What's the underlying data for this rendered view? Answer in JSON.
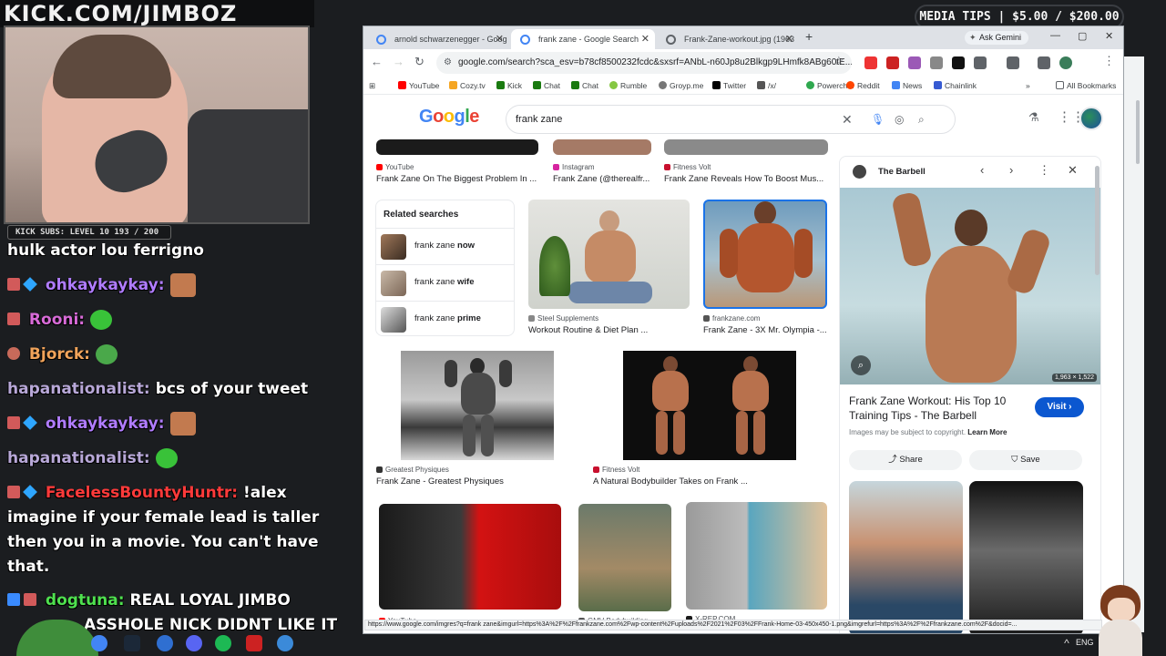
{
  "stream": {
    "channel": "KICK.COM/JIMBOZ",
    "media_tips": "MEDIA TIPS | $5.00 / $200.00",
    "subs_bar": "KICK SUBS: LEVEL 10 193 / 200",
    "chat": [
      {
        "user": "",
        "text": "hulk actor lou ferrigno",
        "user_color": "#ffffff"
      },
      {
        "user": "ohkaykaykay:",
        "text": "",
        "user_color": "#b07cff",
        "emote": "face"
      },
      {
        "user": "Rooni:",
        "text": "",
        "user_color": "#d86bd8",
        "emote": "green"
      },
      {
        "user": "Bjorck:",
        "text": "",
        "user_color": "#f0a35a",
        "emote": "green"
      },
      {
        "user": "hapanationalist:",
        "text": "bcs of your tweet",
        "user_color": "#b8a8d8"
      },
      {
        "user": "ohkaykaykay:",
        "text": "",
        "user_color": "#b07cff",
        "emote": "face"
      },
      {
        "user": "hapanationalist:",
        "text": "",
        "user_color": "#b8a8d8",
        "emote": "green"
      },
      {
        "user": "FacelessBountyHuntr:",
        "text": "!alex",
        "user_color": "#ff3a3a"
      },
      {
        "user": "",
        "text": "imagine if your female lead is taller",
        "user_color": "#ffffff"
      },
      {
        "user": "",
        "text": "then you in a movie. You can't have",
        "user_color": "#ffffff"
      },
      {
        "user": "",
        "text": "that.",
        "user_color": "#ffffff"
      },
      {
        "user": "dogtuna:",
        "text": "REAL LOYAL JIMBO",
        "user_color": "#4fe04f"
      },
      {
        "user": "",
        "text": "ASSHOLE NICK DIDNT LIKE IT",
        "user_color": "#ffffff"
      }
    ],
    "taskbar_lang": "ENG"
  },
  "browser": {
    "tabs": [
      {
        "label": "arnold schwarzenegger - Goog",
        "active": false
      },
      {
        "label": "frank zane - Google Search",
        "active": true
      },
      {
        "label": "Frank-Zane-workout.jpg (1963",
        "active": false
      }
    ],
    "ask_gemini": "Ask Gemini",
    "url": "google.com/search?sca_esv=b78cf8500232fcdc&sxsrf=ANbL-n60Jp8u2Blkgp9LHmfk8ABg60tE...",
    "bookmarks": [
      {
        "label": "YouTube",
        "color": "#ff0000"
      },
      {
        "label": "Cozy.tv",
        "color": "#f5a623"
      },
      {
        "label": "Kick",
        "color": "#53fc18"
      },
      {
        "label": "Chat",
        "color": "#53fc18"
      },
      {
        "label": "Chat",
        "color": "#53fc18"
      },
      {
        "label": "Rumble",
        "color": "#85c742"
      },
      {
        "label": "Groyp.me",
        "color": "#777777"
      },
      {
        "label": "Twitter",
        "color": "#000000"
      },
      {
        "label": "/x/",
        "color": "#555555"
      },
      {
        "label": "Powerchat",
        "color": "#2fa84f"
      },
      {
        "label": "Reddit",
        "color": "#ff4500"
      },
      {
        "label": "News",
        "color": "#4285f4"
      },
      {
        "label": "Chainlink",
        "color": "#375bd2"
      }
    ],
    "all_bookmarks": "All Bookmarks",
    "status_url": "https://www.google.com/imgres?q=frank zane&imgurl=https%3A%2F%2Ffrankzane.com%2Fwp-content%2Fuploads%2F2021%2F03%2FFrank-Home-03-450x450-1.png&imgrefurl=https%3A%2F%2Ffrankzane.com%2F&docid=..."
  },
  "google": {
    "logo": "Google",
    "query": "frank zane",
    "results": [
      {
        "source": "YouTube",
        "title": "Frank Zane On The Biggest Problem In ...",
        "src_color": "#ff0000"
      },
      {
        "source": "Instagram",
        "title": "Frank Zane (@therealfr...",
        "src_color": "#d6249f"
      },
      {
        "source": "Fitness Volt",
        "title": "Frank Zane Reveals How To Boost Mus...",
        "src_color": "#c8102e"
      },
      {
        "source": "Steel Supplements",
        "title": "Workout Routine & Diet Plan ...",
        "src_color": "#888888"
      },
      {
        "source": "frankzane.com",
        "title": "Frank Zane - 3X Mr. Olympia -...",
        "src_color": "#555555"
      },
      {
        "source": "Greatest Physiques",
        "title": "Frank Zane - Greatest Physiques",
        "src_color": "#333333"
      },
      {
        "source": "Fitness Volt",
        "title": "A Natural Bodybuilder Takes on Frank ...",
        "src_color": "#c8102e"
      }
    ],
    "related": {
      "heading": "Related searches",
      "items": [
        {
          "base": "frank zane",
          "bold": "now"
        },
        {
          "base": "frank zane",
          "bold": "wife"
        },
        {
          "base": "frank zane",
          "bold": "prime"
        }
      ]
    },
    "bottom_sources": [
      "YouTube",
      "GMV Bodybuilding",
      "X-REP.COM"
    ]
  },
  "panel": {
    "site": "The Barbell",
    "title": "Frank Zane Workout: His Top 10 Training Tips - The Barbell",
    "visit": "Visit",
    "copyright": "Images may be subject to copyright.",
    "learn_more": "Learn More",
    "share": "Share",
    "save": "Save",
    "dims": "1,963 × 1,522"
  }
}
